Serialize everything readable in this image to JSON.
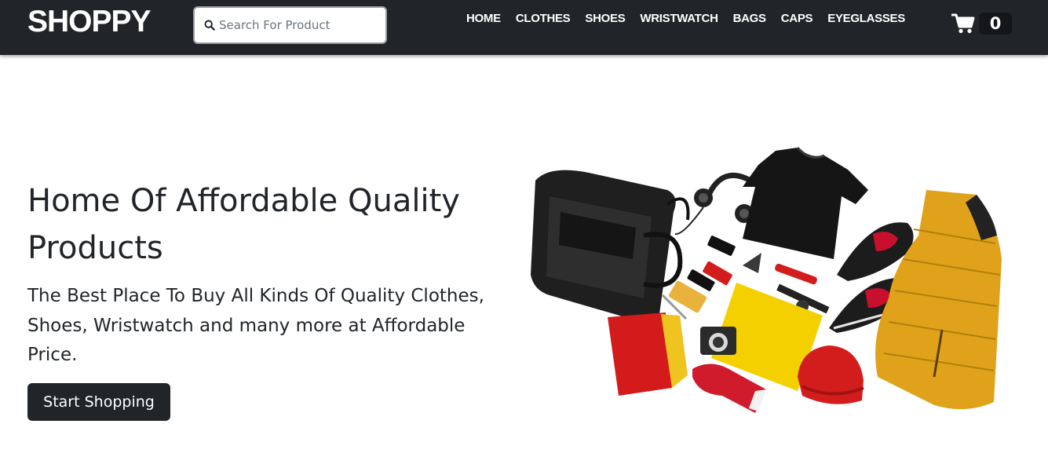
{
  "brand": {
    "name": "SHOPPY"
  },
  "search": {
    "placeholder": "Search For Product",
    "value": "",
    "icon": "search-icon"
  },
  "nav": {
    "links": [
      "HOME",
      "CLOTHES",
      "SHOES",
      "WRISTWATCH",
      "BAGS",
      "CAPS",
      "EYEGLASSES"
    ]
  },
  "cart": {
    "icon": "cart-icon",
    "count": "0"
  },
  "hero": {
    "title": "Home Of Affordable Quality Products",
    "subtitle": "The Best Place To Buy All Kinds Of Quality Clothes, Shoes, Wristwatch and many more at Affordable Price.",
    "cta_label": "Start Shopping"
  },
  "colors": {
    "navbar_bg": "#212529",
    "accent_dark": "#212529",
    "page_bg": "#ffffff"
  }
}
